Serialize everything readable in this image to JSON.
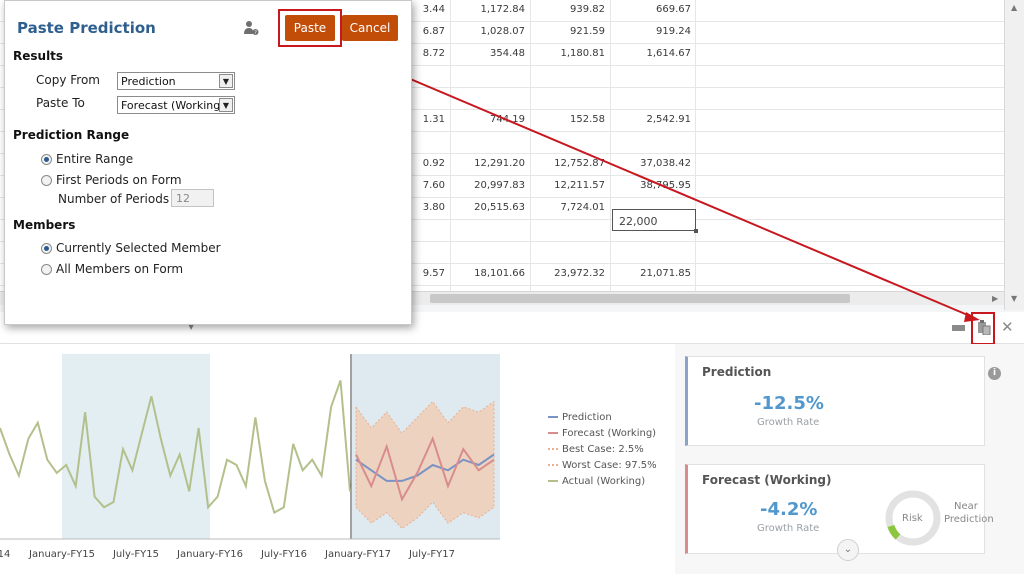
{
  "grid": {
    "rows": [
      {
        "cells": [
          "3.44",
          "1,172.84",
          "939.82",
          "669.67"
        ]
      },
      {
        "cells": [
          "6.87",
          "1,028.07",
          "921.59",
          "919.24"
        ]
      },
      {
        "cells": [
          "8.72",
          "354.48",
          "1,180.81",
          "1,614.67"
        ]
      },
      {
        "cells": [
          "",
          "",
          "",
          ""
        ]
      },
      {
        "cells": [
          "",
          "",
          "",
          ""
        ]
      },
      {
        "cells": [
          "1.31",
          "744.19",
          "152.58",
          "2,542.91"
        ]
      },
      {
        "cells": [
          "",
          "",
          "",
          ""
        ]
      },
      {
        "cells": [
          "0.92",
          "12,291.20",
          "12,752.87",
          "37,038.42"
        ]
      },
      {
        "cells": [
          "7.60",
          "20,997.83",
          "12,211.57",
          "38,795.95"
        ]
      },
      {
        "cells": [
          "3.80",
          "20,515.63",
          "7,724.01",
          ""
        ]
      },
      {
        "cells": [
          "",
          "",
          "",
          ""
        ]
      },
      {
        "cells": [
          "",
          "",
          "",
          ""
        ]
      },
      {
        "cells": [
          "9.57",
          "18,101.66",
          "23,972.32",
          "21,071.85"
        ]
      }
    ],
    "edit_cell_value": "22,000"
  },
  "dialog": {
    "title": "Paste Prediction",
    "paste_label": "Paste",
    "cancel_label": "Cancel",
    "results_heading": "Results",
    "copy_from_label": "Copy From",
    "copy_from_value": "Prediction",
    "paste_to_label": "Paste To",
    "paste_to_value": "Forecast (Working)",
    "range_heading": "Prediction Range",
    "entire_range": "Entire Range",
    "first_periods": "First Periods on Form",
    "num_periods_label": "Number of Periods",
    "num_periods_value": "12",
    "members_heading": "Members",
    "current_member": "Currently Selected Member",
    "all_members": "All Members on Form"
  },
  "chart_data": {
    "type": "line",
    "x_tick_labels": [
      "14",
      "January-FY15",
      "July-FY15",
      "January-FY16",
      "July-FY16",
      "January-FY17",
      "July-FY17"
    ],
    "legend": [
      "Prediction",
      "Forecast (Working)",
      "Best Case: 2.5%",
      "Worst Case: 97.5%",
      "Actual (Working)"
    ],
    "series": [
      {
        "name": "Actual (Working)",
        "color": "#b4c08c",
        "values": [
          52,
          42,
          34,
          48,
          54,
          40,
          35,
          38,
          30,
          58,
          26,
          22,
          24,
          44,
          36,
          50,
          64,
          48,
          34,
          42,
          28,
          52,
          22,
          26,
          40,
          38,
          30,
          56,
          32,
          20,
          22,
          46,
          36,
          40,
          34,
          60,
          70,
          28
        ]
      },
      {
        "name": "Prediction",
        "color": "#7b93c4",
        "values": [
          40,
          36,
          32,
          32,
          34,
          38,
          36,
          40,
          38,
          42
        ]
      },
      {
        "name": "Forecast (Working)",
        "color": "#d98c8c",
        "values": [
          42,
          30,
          45,
          25,
          35,
          48,
          30,
          44,
          36,
          40
        ]
      },
      {
        "name": "Best Case: 2.5%",
        "color": "#e8b090",
        "values": [
          60,
          52,
          58,
          50,
          56,
          62,
          54,
          60,
          58,
          62
        ]
      },
      {
        "name": "Worst Case: 97.5%",
        "color": "#e8b090",
        "values": [
          22,
          16,
          20,
          14,
          18,
          24,
          16,
          20,
          18,
          22
        ]
      }
    ]
  },
  "prediction_card": {
    "title": "Prediction",
    "value": "-12.5%",
    "sub": "Growth Rate",
    "color": "#4f97cc"
  },
  "forecast_card": {
    "title": "Forecast (Working)",
    "value": "-4.2%",
    "sub": "Growth Rate",
    "risk": "Risk",
    "near": "Near",
    "prediction_word": "Prediction",
    "color": "#4f97cc"
  },
  "colors": {
    "accent": "#c24d08",
    "highlight": "#c8171e",
    "dialog_title": "#2e5f8e"
  }
}
